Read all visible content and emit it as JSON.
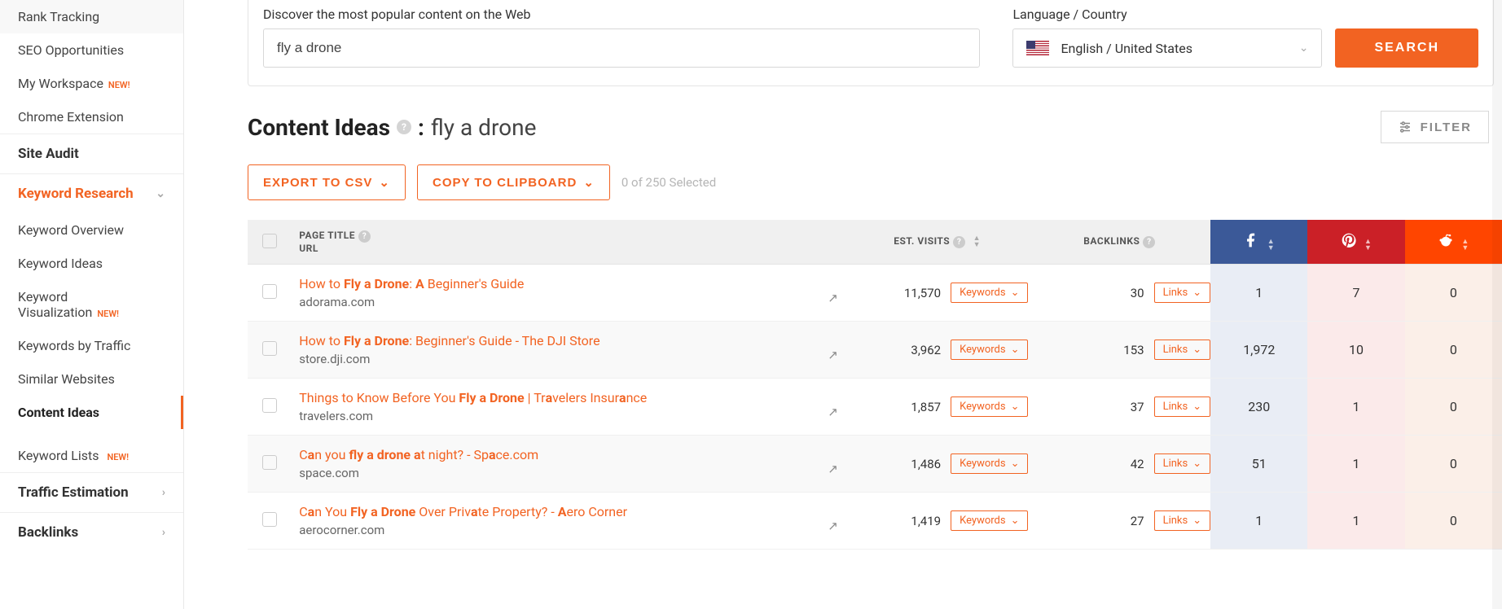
{
  "sidebar": {
    "topItems": [
      {
        "label": "Rank Tracking",
        "new": false
      },
      {
        "label": "SEO Opportunities",
        "new": false
      },
      {
        "label": "My Workspace",
        "new": true
      },
      {
        "label": "Chrome Extension",
        "new": false
      }
    ],
    "siteAudit": "Site Audit",
    "keywordResearch": "Keyword Research",
    "krItems": [
      {
        "label": "Keyword Overview",
        "new": false
      },
      {
        "label": "Keyword Ideas",
        "new": false
      },
      {
        "label": "Keyword Visualization",
        "new": true
      },
      {
        "label": "Keywords by Traffic",
        "new": false
      },
      {
        "label": "Similar Websites",
        "new": false
      },
      {
        "label": "Content Ideas",
        "new": false,
        "active": true
      }
    ],
    "keywordLists": {
      "label": "Keyword Lists",
      "new": true
    },
    "trafficEstimation": "Traffic Estimation",
    "backlinks": "Backlinks"
  },
  "search": {
    "discoverLabel": "Discover the most popular content on the Web",
    "value": "fly a drone",
    "langLabel": "Language / Country",
    "langValue": "English / United States",
    "button": "SEARCH"
  },
  "page": {
    "titlePrefix": "Content Ideas",
    "query": "fly a drone",
    "filter": "FILTER"
  },
  "toolbar": {
    "export": "EXPORT TO CSV",
    "copy": "COPY TO CLIPBOARD",
    "selected": "0 of 250 Selected"
  },
  "columns": {
    "pageTitle": "PAGE TITLE",
    "url": "URL",
    "estVisits": "EST. VISITS",
    "backlinks": "BACKLINKS",
    "keywordsBtn": "Keywords",
    "linksBtn": "Links"
  },
  "rows": [
    {
      "titleParts": [
        "How to ",
        "Fly a Drone",
        ": ",
        "A",
        " Beginner's Guide"
      ],
      "url": "adorama.com",
      "visits": "11,570",
      "backlinks": "30",
      "fb": "1",
      "pin": "7",
      "rd": "0"
    },
    {
      "titleParts": [
        "How to ",
        "Fly a Drone",
        ": Beginner's Guide - The DJI Store"
      ],
      "url": "store.dji.com",
      "visits": "3,962",
      "backlinks": "153",
      "fb": "1,972",
      "pin": "10",
      "rd": "0"
    },
    {
      "titleParts": [
        "Things to Know Before You ",
        "Fly a Drone",
        " | Tr",
        "a",
        "velers Insur",
        "a",
        "nce"
      ],
      "url": "travelers.com",
      "visits": "1,857",
      "backlinks": "37",
      "fb": "230",
      "pin": "1",
      "rd": "0"
    },
    {
      "titleParts": [
        "C",
        "a",
        "n you ",
        "fly a drone a",
        "t night? - Sp",
        "a",
        "ce.com"
      ],
      "url": "space.com",
      "visits": "1,486",
      "backlinks": "42",
      "fb": "51",
      "pin": "1",
      "rd": "0"
    },
    {
      "titleParts": [
        "C",
        "a",
        "n You ",
        "Fly a Drone",
        " Over Priv",
        "a",
        "te Property? - ",
        "A",
        "ero Corner"
      ],
      "url": "aerocorner.com",
      "visits": "1,419",
      "backlinks": "27",
      "fb": "1",
      "pin": "1",
      "rd": "0"
    }
  ]
}
